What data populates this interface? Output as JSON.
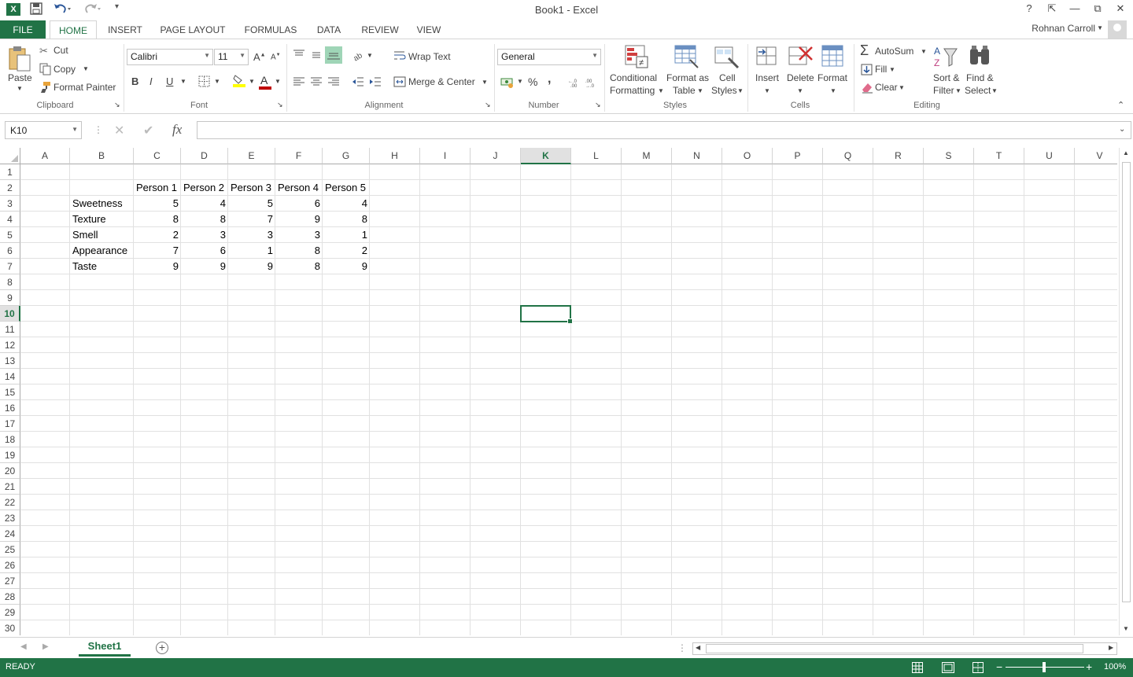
{
  "window": {
    "title": "Book1 - Excel"
  },
  "ribbon_tabs": [
    {
      "label": "FILE"
    },
    {
      "label": "HOME"
    },
    {
      "label": "INSERT"
    },
    {
      "label": "PAGE LAYOUT"
    },
    {
      "label": "FORMULAS"
    },
    {
      "label": "DATA"
    },
    {
      "label": "REVIEW"
    },
    {
      "label": "VIEW"
    }
  ],
  "user": {
    "name": "Rohnan Carroll"
  },
  "clipboard": {
    "paste": "Paste",
    "cut": "Cut",
    "copy": "Copy",
    "format_painter": "Format Painter",
    "label": "Clipboard"
  },
  "font": {
    "name": "Calibri",
    "size": "11",
    "label": "Font",
    "bold": "B",
    "italic": "I",
    "underline": "U",
    "color_letter": "A"
  },
  "alignment": {
    "wrap_text": "Wrap Text",
    "merge_center": "Merge & Center",
    "label": "Alignment"
  },
  "number": {
    "format": "General",
    "label": "Number",
    "percent": "%",
    "comma": ","
  },
  "styles": {
    "conditional_1": "Conditional",
    "conditional_2": "Formatting",
    "format_table_1": "Format as",
    "format_table_2": "Table",
    "cell_styles_1": "Cell",
    "cell_styles_2": "Styles",
    "label": "Styles"
  },
  "cells": {
    "insert": "Insert",
    "delete": "Delete",
    "format": "Format",
    "label": "Cells"
  },
  "editing": {
    "autosum": "AutoSum",
    "fill": "Fill",
    "clear": "Clear",
    "sort_1": "Sort &",
    "sort_2": "Filter",
    "find_1": "Find &",
    "find_2": "Select",
    "label": "Editing"
  },
  "formula_bar": {
    "name_box": "K10",
    "fx": "fx",
    "content": ""
  },
  "columns": [
    "A",
    "B",
    "C",
    "D",
    "E",
    "F",
    "G",
    "H",
    "I",
    "J",
    "K",
    "L",
    "M",
    "N",
    "O",
    "P",
    "Q",
    "R",
    "S",
    "T",
    "U",
    "V"
  ],
  "selected_column": "K",
  "selected_row": "10",
  "rows": [
    "1",
    "2",
    "3",
    "4",
    "5",
    "6",
    "7",
    "8",
    "9",
    "10",
    "11",
    "12",
    "13",
    "14",
    "15",
    "16",
    "17",
    "18",
    "19",
    "20",
    "21",
    "22",
    "23",
    "24",
    "25",
    "26",
    "27",
    "28",
    "29",
    "30"
  ],
  "table": {
    "headers": [
      "Person 1",
      "Person 2",
      "Person 3",
      "Person 4",
      "Person 5"
    ],
    "rows": [
      {
        "label": "Sweetness",
        "values": [
          "5",
          "4",
          "5",
          "6",
          "4"
        ]
      },
      {
        "label": "Texture",
        "values": [
          "8",
          "8",
          "7",
          "9",
          "8"
        ]
      },
      {
        "label": "Smell",
        "values": [
          "2",
          "3",
          "3",
          "3",
          "1"
        ]
      },
      {
        "label": "Appearance",
        "values": [
          "7",
          "6",
          "1",
          "8",
          "2"
        ]
      },
      {
        "label": "Taste",
        "values": [
          "9",
          "9",
          "9",
          "8",
          "9"
        ]
      }
    ]
  },
  "sheets": [
    "Sheet1"
  ],
  "status": {
    "mode": "READY",
    "zoom": "100%"
  },
  "colors": {
    "accent": "#217346"
  }
}
